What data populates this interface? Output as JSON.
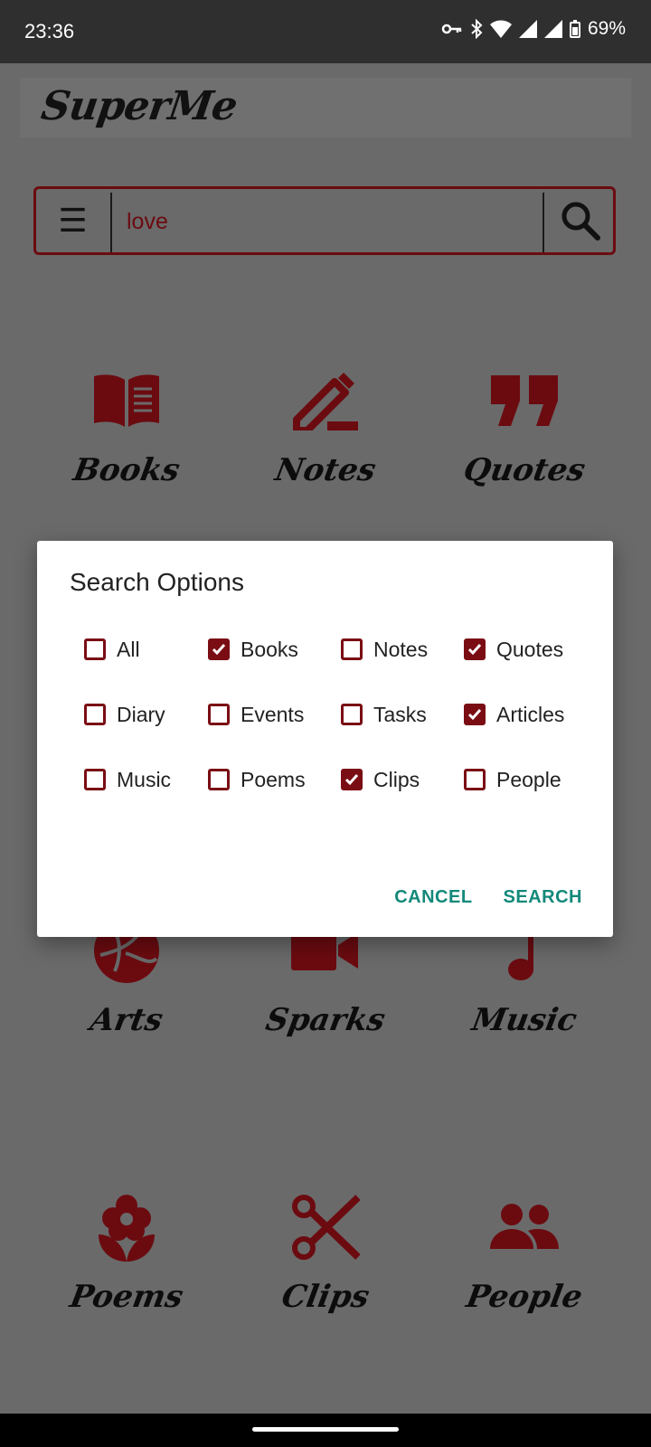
{
  "status": {
    "time": "23:36",
    "battery": "69%"
  },
  "app": {
    "logo": "SuperMe"
  },
  "search": {
    "value": "love"
  },
  "tiles": [
    {
      "label": "Books"
    },
    {
      "label": "Notes"
    },
    {
      "label": "Quotes"
    },
    {
      "label": "Arts"
    },
    {
      "label": "Sparks"
    },
    {
      "label": "Music"
    },
    {
      "label": "Poems"
    },
    {
      "label": "Clips"
    },
    {
      "label": "People"
    }
  ],
  "dialog": {
    "title": "Search Options",
    "options": [
      {
        "label": "All",
        "checked": false
      },
      {
        "label": "Books",
        "checked": true
      },
      {
        "label": "Notes",
        "checked": false
      },
      {
        "label": "Quotes",
        "checked": true
      },
      {
        "label": "Diary",
        "checked": false
      },
      {
        "label": "Events",
        "checked": false
      },
      {
        "label": "Tasks",
        "checked": false
      },
      {
        "label": "Articles",
        "checked": true
      },
      {
        "label": "Music",
        "checked": false
      },
      {
        "label": "Poems",
        "checked": false
      },
      {
        "label": "Clips",
        "checked": true
      },
      {
        "label": "People",
        "checked": false
      }
    ],
    "cancel_label": "CANCEL",
    "search_label": "SEARCH"
  },
  "colors": {
    "accent": "#7a0d14",
    "button_text": "#13897a",
    "scrim": "#6a6a6a"
  }
}
